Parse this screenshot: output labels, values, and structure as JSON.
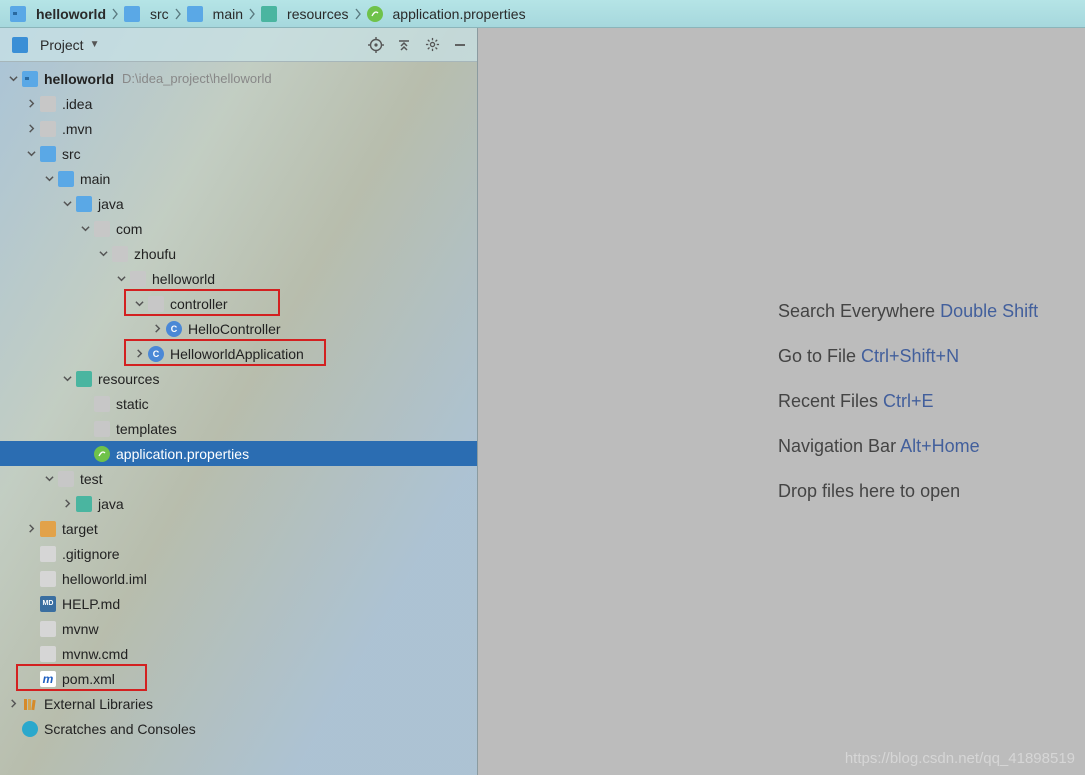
{
  "breadcrumb": [
    {
      "label": "helloworld",
      "icon": "module",
      "bold": true
    },
    {
      "label": "src",
      "icon": "folder-blue"
    },
    {
      "label": "main",
      "icon": "folder-blue"
    },
    {
      "label": "resources",
      "icon": "folder-teal"
    },
    {
      "label": "application.properties",
      "icon": "spring"
    }
  ],
  "toolwindow": {
    "title": "Project"
  },
  "toolbar_icons": [
    "target",
    "collapse",
    "settings",
    "hide"
  ],
  "tree": {
    "root": {
      "label": "helloworld",
      "path": "D:\\idea_project\\helloworld"
    }
  },
  "nodes": [
    {
      "depth": 0,
      "arrow": "down",
      "icon": "module",
      "label": "helloworld",
      "bold": true,
      "hint": "D:\\idea_project\\helloworld"
    },
    {
      "depth": 1,
      "arrow": "right",
      "icon": "folder",
      "label": ".idea"
    },
    {
      "depth": 1,
      "arrow": "right",
      "icon": "folder",
      "label": ".mvn"
    },
    {
      "depth": 1,
      "arrow": "down",
      "icon": "folder-blue",
      "label": "src"
    },
    {
      "depth": 2,
      "arrow": "down",
      "icon": "folder-blue",
      "label": "main"
    },
    {
      "depth": 3,
      "arrow": "down",
      "icon": "folder-blue",
      "label": "java"
    },
    {
      "depth": 4,
      "arrow": "down",
      "icon": "folder",
      "label": "com"
    },
    {
      "depth": 5,
      "arrow": "down",
      "icon": "folder",
      "label": "zhoufu"
    },
    {
      "depth": 6,
      "arrow": "down",
      "icon": "folder",
      "label": "helloworld"
    },
    {
      "depth": 7,
      "arrow": "down",
      "icon": "folder",
      "label": "controller",
      "boxed": "b1"
    },
    {
      "depth": 8,
      "arrow": "right",
      "icon": "class",
      "label": "HelloController"
    },
    {
      "depth": 7,
      "arrow": "right",
      "icon": "spring-class",
      "label": "HelloworldApplication",
      "boxed": "b2"
    },
    {
      "depth": 3,
      "arrow": "down",
      "icon": "folder-teal",
      "label": "resources"
    },
    {
      "depth": 4,
      "arrow": "none",
      "icon": "folder",
      "label": "static"
    },
    {
      "depth": 4,
      "arrow": "none",
      "icon": "folder",
      "label": "templates"
    },
    {
      "depth": 4,
      "arrow": "none",
      "icon": "spring",
      "label": "application.properties",
      "selected": true
    },
    {
      "depth": 2,
      "arrow": "down",
      "icon": "folder",
      "label": "test"
    },
    {
      "depth": 3,
      "arrow": "right",
      "icon": "folder-green",
      "label": "java"
    },
    {
      "depth": 1,
      "arrow": "right",
      "icon": "folder-orange",
      "label": "target"
    },
    {
      "depth": 1,
      "arrow": "none",
      "icon": "file",
      "label": ".gitignore"
    },
    {
      "depth": 1,
      "arrow": "none",
      "icon": "file",
      "label": "helloworld.iml"
    },
    {
      "depth": 1,
      "arrow": "none",
      "icon": "md",
      "label": "HELP.md"
    },
    {
      "depth": 1,
      "arrow": "none",
      "icon": "file",
      "label": "mvnw"
    },
    {
      "depth": 1,
      "arrow": "none",
      "icon": "file",
      "label": "mvnw.cmd"
    },
    {
      "depth": 1,
      "arrow": "none",
      "icon": "maven",
      "label": "pom.xml",
      "boxed": "b3"
    },
    {
      "depth": 0,
      "arrow": "right",
      "icon": "lib",
      "label": "External Libraries"
    },
    {
      "depth": 0,
      "arrow": "none",
      "icon": "scratch",
      "label": "Scratches and Consoles"
    }
  ],
  "tips": [
    {
      "text": "Search Everywhere",
      "key": "Double Shift"
    },
    {
      "text": "Go to File",
      "key": "Ctrl+Shift+N"
    },
    {
      "text": "Recent Files",
      "key": "Ctrl+E"
    },
    {
      "text": "Navigation Bar",
      "key": "Alt+Home"
    },
    {
      "text": "Drop files here to open",
      "key": ""
    }
  ],
  "watermark": "https://blog.csdn.net/qq_41898519"
}
